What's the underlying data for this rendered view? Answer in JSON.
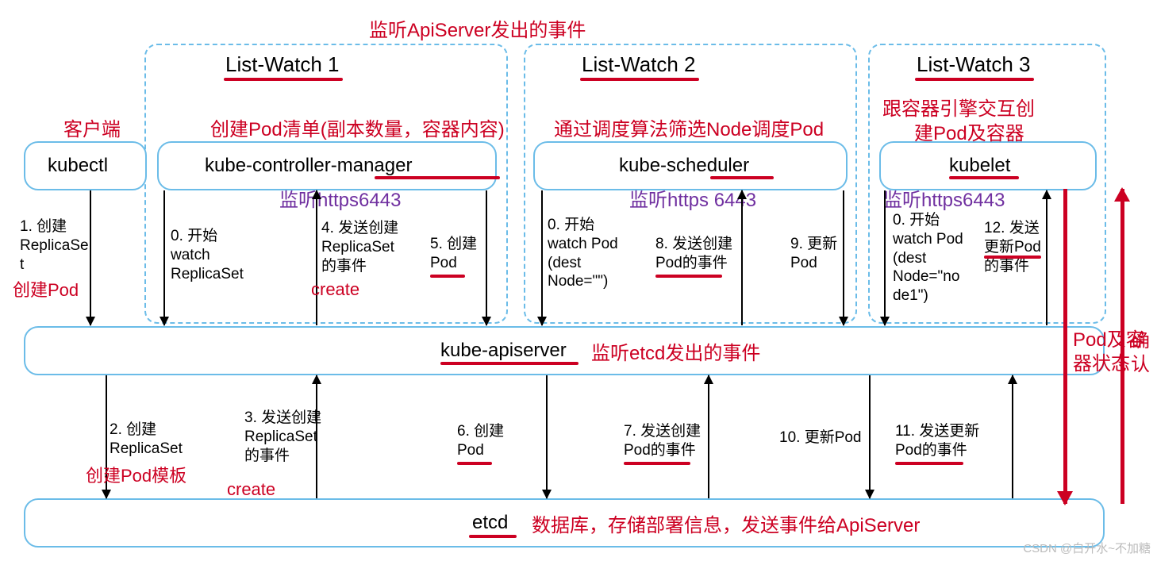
{
  "title_top": "监听ApiServer发出的事件",
  "watch1": "List-Watch 1",
  "watch2": "List-Watch 2",
  "watch3": "List-Watch 3",
  "client_label": "客户端",
  "kubectl": "kubectl",
  "kcm": "kube-controller-manager",
  "kcm_anno": "创建Pod清单(副本数量，容器内容)",
  "ksched": "kube-scheduler",
  "ksched_anno": "通过调度算法筛选Node调度Pod",
  "kubelet": "kubelet",
  "kubelet_anno1": "跟容器引擎交互创",
  "kubelet_anno2": "建Pod及容器",
  "listen1": "监听https6443",
  "listen2": "监听https 6443",
  "listen3": "监听https6443",
  "apiserver": "kube-apiserver",
  "apiserver_anno": "监听etcd发出的事件",
  "etcd": "etcd",
  "etcd_anno": "数据库，存储部署信息，发送事件给ApiServer",
  "step1": "1. 创建\nReplicaSe\nt",
  "step1_red": "创建Pod",
  "step0a": "0. 开始\nwatch\nReplicaSet",
  "step4": "4. 发送创建\nReplicaSet\n的事件",
  "step4_red": "create",
  "step5": "5. 创建\nPod",
  "step0b": "0. 开始\nwatch Pod\n(dest\nNode=\"\")",
  "step8": "8. 发送创建\nPod的事件",
  "step9": "9. 更新\nPod",
  "step0c": "0. 开始\nwatch Pod\n(dest\nNode=\"no\nde1\")",
  "step12": "12. 发送\n更新Pod\n的事件",
  "step2": "2. 创建\nReplicaSet",
  "step2_red": "创建Pod模板",
  "step3": "3. 发送创建\nReplicaSet\n的事件",
  "step3_red": "create",
  "step6": "6. 创建\nPod",
  "step7": "7. 发送创建\nPod的事件",
  "step10": "10. 更新Pod",
  "step11": "11. 发送更新\nPod的事件",
  "pod_status": "Pod及容\n器状态",
  "confirm": "确\n认",
  "watermark": "CSDN @白开水~不加糖"
}
